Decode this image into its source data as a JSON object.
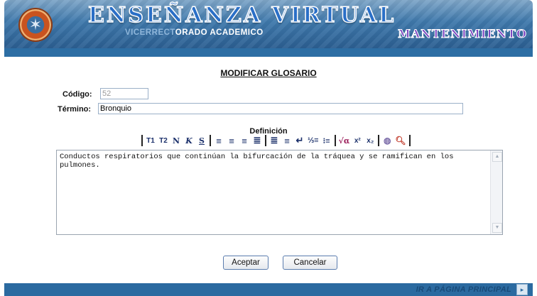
{
  "header": {
    "title": "ENSEÑANZA VIRTUAL",
    "subtitle_dim": "VICERRECT",
    "subtitle": "ORADO ACADEMICO",
    "section": "MANTENIMIENTO"
  },
  "form": {
    "title": "MODIFICAR GLOSARIO",
    "codigo_label": "Código:",
    "codigo_value": "52",
    "termino_label": "Término:",
    "termino_value": "Bronquio",
    "definicion_label": "Definición",
    "definicion_text": "Conductos respiratorios que continúan la bifurcación de la tráquea y se ramifican en los pulmones."
  },
  "toolbar": {
    "t1": "T1",
    "t2": "T2",
    "bold": "N",
    "italic": "K",
    "underline": "S",
    "superscript": "x²",
    "subscript": "x₂",
    "sqrt": "√α"
  },
  "buttons": {
    "accept": "Aceptar",
    "cancel": "Cancelar"
  },
  "footer": {
    "link": "IR A PÁGINA PRINCIPAL"
  }
}
